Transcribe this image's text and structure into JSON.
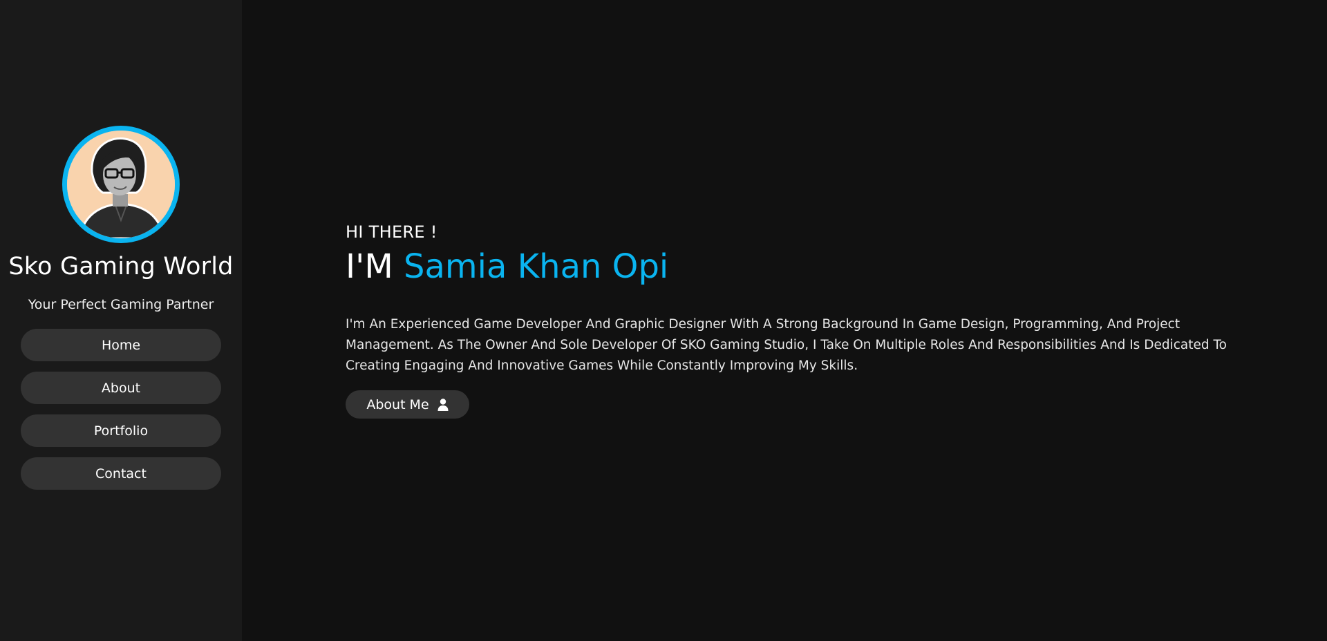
{
  "sidebar": {
    "avatar_icon": "profile-photo",
    "title": "Sko Gaming World",
    "tagline": "Your Perfect Gaming Partner",
    "nav": [
      {
        "label": "Home"
      },
      {
        "label": "About"
      },
      {
        "label": "Portfolio"
      },
      {
        "label": "Contact"
      }
    ]
  },
  "hero": {
    "greeting": "HI THERE !",
    "headline_prefix": "I'M ",
    "name": "Samia Khan Opi",
    "bio": "I'm An Experienced Game Developer And Graphic Designer With A Strong Background In Game Design, Programming, And Project Management. As The Owner And Sole Developer Of SKO Gaming Studio, I Take On Multiple Roles And Responsibilities And Is Dedicated To Creating Engaging And Innovative Games While Constantly Improving My Skills.",
    "cta_label": "About Me",
    "cta_icon": "user-icon"
  },
  "colors": {
    "accent": "#0ab4f0",
    "background": "#111111",
    "sidebar": "#1a1a1a",
    "button": "#333333",
    "avatar_bg": "#f9d3ad"
  }
}
